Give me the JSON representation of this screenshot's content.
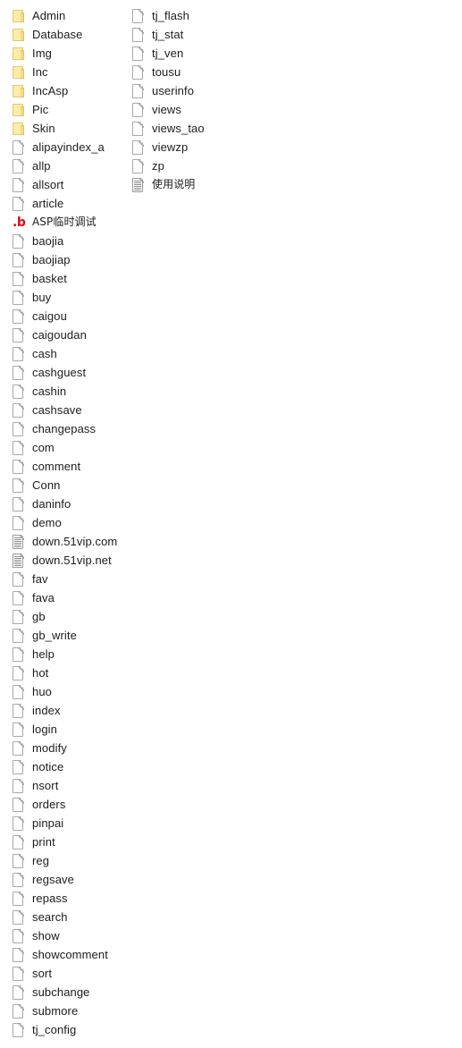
{
  "view": {
    "name": "file-listing",
    "background_color": "#ffffff",
    "text_color": "#1c1c1c",
    "folder_color": "#fcecab",
    "accent_color": "#e50914",
    "columns": 2
  },
  "icons": {
    "folder": "folder-icon",
    "page": "page-icon",
    "doc": "text-document-icon",
    "dotb": "red-dot-b-icon"
  },
  "columns": [
    {
      "name": "column-1",
      "items": [
        {
          "label": "Admin",
          "icon": "folder"
        },
        {
          "label": "Database",
          "icon": "folder"
        },
        {
          "label": "Img",
          "icon": "folder"
        },
        {
          "label": "Inc",
          "icon": "folder"
        },
        {
          "label": "IncAsp",
          "icon": "folder"
        },
        {
          "label": "Pic",
          "icon": "folder"
        },
        {
          "label": "Skin",
          "icon": "folder"
        },
        {
          "label": "alipayindex_a",
          "icon": "page"
        },
        {
          "label": "allp",
          "icon": "page"
        },
        {
          "label": "allsort",
          "icon": "page"
        },
        {
          "label": "article",
          "icon": "page"
        },
        {
          "label": "ASP临时调试",
          "icon": "dotb",
          "cjk": true
        },
        {
          "label": "baojia",
          "icon": "page"
        },
        {
          "label": "baojiap",
          "icon": "page"
        },
        {
          "label": "basket",
          "icon": "page"
        },
        {
          "label": "buy",
          "icon": "page"
        },
        {
          "label": "caigou",
          "icon": "page"
        },
        {
          "label": "caigoudan",
          "icon": "page"
        },
        {
          "label": "cash",
          "icon": "page"
        },
        {
          "label": "cashguest",
          "icon": "page"
        },
        {
          "label": "cashin",
          "icon": "page"
        },
        {
          "label": "cashsave",
          "icon": "page"
        },
        {
          "label": "changepass",
          "icon": "page"
        },
        {
          "label": "com",
          "icon": "page"
        },
        {
          "label": "comment",
          "icon": "page"
        },
        {
          "label": "Conn",
          "icon": "page"
        },
        {
          "label": "daninfo",
          "icon": "page"
        },
        {
          "label": "demo",
          "icon": "page"
        },
        {
          "label": "down.51vip.com",
          "icon": "doc"
        },
        {
          "label": "down.51vip.net",
          "icon": "doc"
        },
        {
          "label": "fav",
          "icon": "page"
        },
        {
          "label": "fava",
          "icon": "page"
        },
        {
          "label": "gb",
          "icon": "page"
        },
        {
          "label": "gb_write",
          "icon": "page"
        },
        {
          "label": "help",
          "icon": "page"
        },
        {
          "label": "hot",
          "icon": "page"
        },
        {
          "label": "huo",
          "icon": "page"
        },
        {
          "label": "index",
          "icon": "page"
        },
        {
          "label": "login",
          "icon": "page"
        },
        {
          "label": "modify",
          "icon": "page"
        },
        {
          "label": "notice",
          "icon": "page"
        },
        {
          "label": "nsort",
          "icon": "page"
        },
        {
          "label": "orders",
          "icon": "page"
        },
        {
          "label": "pinpai",
          "icon": "page"
        },
        {
          "label": "print",
          "icon": "page"
        },
        {
          "label": "reg",
          "icon": "page"
        },
        {
          "label": "regsave",
          "icon": "page"
        },
        {
          "label": "repass",
          "icon": "page"
        },
        {
          "label": "search",
          "icon": "page"
        },
        {
          "label": "show",
          "icon": "page"
        },
        {
          "label": "showcomment",
          "icon": "page"
        },
        {
          "label": "sort",
          "icon": "page"
        },
        {
          "label": "subchange",
          "icon": "page"
        },
        {
          "label": "submore",
          "icon": "page"
        },
        {
          "label": "tj_config",
          "icon": "page"
        }
      ]
    },
    {
      "name": "column-2",
      "items": [
        {
          "label": "tj_flash",
          "icon": "page"
        },
        {
          "label": "tj_stat",
          "icon": "page"
        },
        {
          "label": "tj_ven",
          "icon": "page"
        },
        {
          "label": "tousu",
          "icon": "page"
        },
        {
          "label": "userinfo",
          "icon": "page"
        },
        {
          "label": "views",
          "icon": "page"
        },
        {
          "label": "views_tao",
          "icon": "page"
        },
        {
          "label": "viewzp",
          "icon": "page"
        },
        {
          "label": "zp",
          "icon": "page"
        },
        {
          "label": "使用说明",
          "icon": "doc",
          "cjk": true
        }
      ]
    }
  ]
}
